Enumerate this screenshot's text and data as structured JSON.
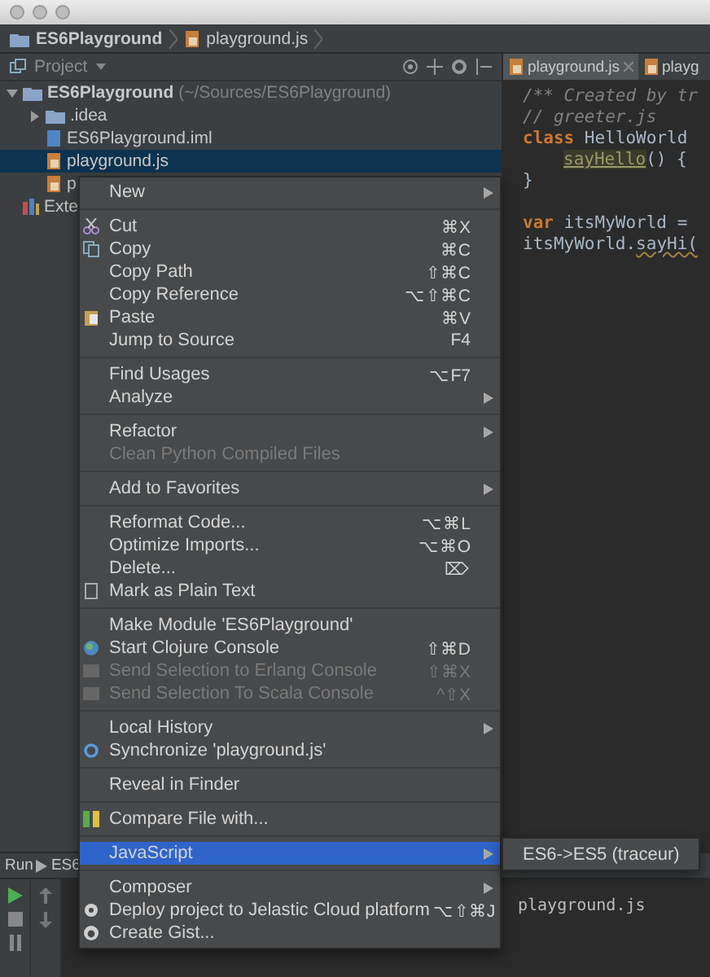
{
  "breadcrumb": [
    {
      "label": "ES6Playground"
    },
    {
      "label": "playground.js"
    }
  ],
  "project_panel": {
    "title": "Project",
    "tree": [
      {
        "label": "ES6Playground",
        "path": "(~/Sources/ES6Playground)",
        "expanded": true,
        "selected": false,
        "children": [
          {
            "label": ".idea",
            "expanded": false,
            "selected": false
          },
          {
            "label": "ES6Playground.iml",
            "selected": false
          },
          {
            "label": "playground.js",
            "selected": true
          },
          {
            "label": "p",
            "selected": false
          }
        ]
      },
      {
        "label": "Exte",
        "selected": false
      }
    ]
  },
  "editor": {
    "tabs": [
      {
        "label": "playground.js",
        "selected": true,
        "closable": true
      },
      {
        "label": "playg",
        "selected": false,
        "closable": false
      }
    ],
    "lines": [
      {
        "indented": false,
        "gap_before": false,
        "tokens": [
          {
            "kind": "comment",
            "text": "/** Created by tr"
          }
        ]
      },
      {
        "indented": false,
        "gap_before": false,
        "tokens": [
          {
            "kind": "comment",
            "text": "// greeter.js"
          }
        ]
      },
      {
        "indented": false,
        "gap_before": false,
        "tokens": [
          {
            "kind": "keyword",
            "text": "class"
          },
          {
            "kind": "plain",
            "text": " HelloWorld"
          }
        ]
      },
      {
        "indented": true,
        "gap_before": false,
        "tokens": [
          {
            "kind": "unused",
            "text": "sayHello"
          },
          {
            "kind": "plain",
            "text": "() {"
          }
        ]
      },
      {
        "indented": false,
        "gap_before": false,
        "tokens": [
          {
            "kind": "plain",
            "text": "}"
          }
        ]
      },
      {
        "indented": false,
        "gap_before": true,
        "tokens": [
          {
            "kind": "keyword",
            "text": "var"
          },
          {
            "kind": "plain",
            "text": " itsMyWorld ="
          }
        ]
      },
      {
        "indented": false,
        "gap_before": false,
        "tokens": [
          {
            "kind": "plain",
            "text": "itsMyWorld."
          },
          {
            "kind": "warning",
            "text": "sayHi("
          }
        ]
      }
    ]
  },
  "run_panel": {
    "title": "Run",
    "tab": "ES6",
    "output": "playground.js"
  },
  "context_menu": {
    "groups": [
      [
        {
          "label": "New",
          "submenu": true,
          "disabled": false,
          "selected": false
        }
      ],
      [
        {
          "label": "Cut",
          "shortcut": "⌘X",
          "disabled": false,
          "selected": false
        },
        {
          "label": "Copy",
          "shortcut": "⌘C",
          "disabled": false,
          "selected": false
        },
        {
          "label": "Copy Path",
          "shortcut": "⇧⌘C",
          "disabled": false,
          "selected": false
        },
        {
          "label": "Copy Reference",
          "shortcut": "⌥⇧⌘C",
          "disabled": false,
          "selected": false
        },
        {
          "label": "Paste",
          "shortcut": "⌘V",
          "disabled": false,
          "selected": false
        },
        {
          "label": "Jump to Source",
          "shortcut": "F4",
          "disabled": false,
          "selected": false
        }
      ],
      [
        {
          "label": "Find Usages",
          "shortcut": "⌥F7",
          "disabled": false,
          "selected": false
        },
        {
          "label": "Analyze",
          "submenu": true,
          "disabled": false,
          "selected": false
        }
      ],
      [
        {
          "label": "Refactor",
          "submenu": true,
          "disabled": false,
          "selected": false
        },
        {
          "label": "Clean Python Compiled Files",
          "disabled": true,
          "selected": false
        }
      ],
      [
        {
          "label": "Add to Favorites",
          "submenu": true,
          "disabled": false,
          "selected": false
        }
      ],
      [
        {
          "label": "Reformat Code...",
          "shortcut": "⌥⌘L",
          "disabled": false,
          "selected": false
        },
        {
          "label": "Optimize Imports...",
          "shortcut": "⌥⌘O",
          "disabled": false,
          "selected": false
        },
        {
          "label": "Delete...",
          "shortcut": "⌦",
          "disabled": false,
          "selected": false
        },
        {
          "label": "Mark as Plain Text",
          "disabled": false,
          "selected": false
        }
      ],
      [
        {
          "label": "Make Module 'ES6Playground'",
          "disabled": false,
          "selected": false
        },
        {
          "label": "Start Clojure Console",
          "shortcut": "⇧⌘D",
          "disabled": false,
          "selected": false
        },
        {
          "label": "Send Selection to Erlang Console",
          "shortcut": "⇧⌘X",
          "disabled": true,
          "selected": false
        },
        {
          "label": "Send Selection To Scala Console",
          "shortcut": "^⇧X",
          "disabled": true,
          "selected": false
        }
      ],
      [
        {
          "label": "Local History",
          "submenu": true,
          "disabled": false,
          "selected": false
        },
        {
          "label": "Synchronize 'playground.js'",
          "disabled": false,
          "selected": false
        }
      ],
      [
        {
          "label": "Reveal in Finder",
          "disabled": false,
          "selected": false
        }
      ],
      [
        {
          "label": "Compare File with...",
          "disabled": false,
          "selected": false
        }
      ],
      [
        {
          "label": "JavaScript",
          "submenu": true,
          "disabled": false,
          "selected": true,
          "children": [
            {
              "label": "ES6->ES5 (traceur)"
            }
          ]
        }
      ],
      [
        {
          "label": "Composer",
          "submenu": true,
          "disabled": false,
          "selected": false
        },
        {
          "label": "Deploy project to Jelastic Cloud platform",
          "shortcut": "⌥⇧⌘J",
          "disabled": false,
          "selected": false
        },
        {
          "label": "Create Gist...",
          "disabled": false,
          "selected": false
        }
      ]
    ]
  }
}
